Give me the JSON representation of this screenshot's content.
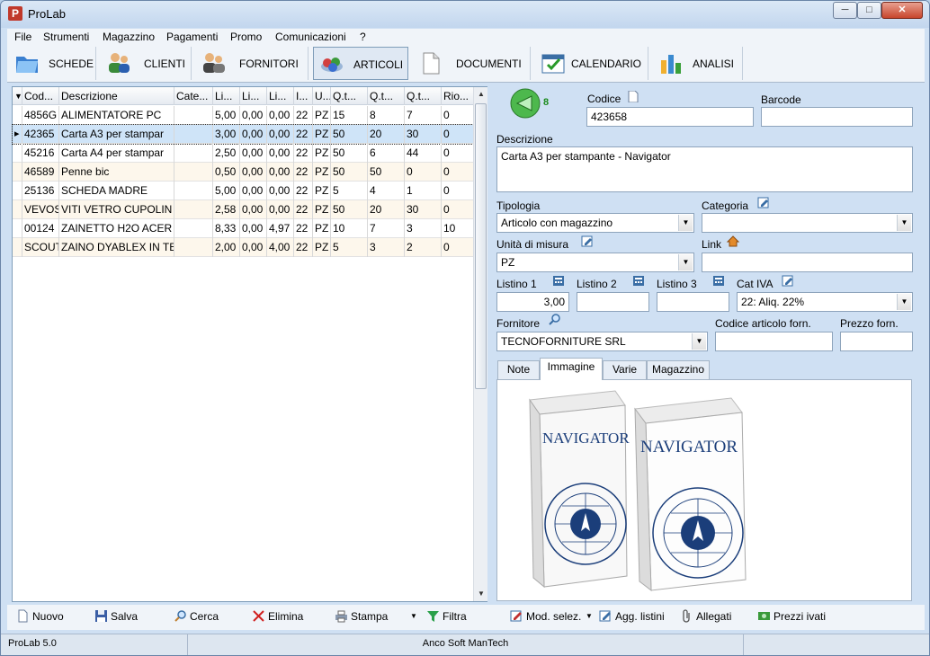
{
  "window": {
    "title": "ProLab"
  },
  "menu": [
    "File",
    "Strumenti",
    "Magazzino",
    "Pagamenti",
    "Promo",
    "Comunicazioni",
    "?"
  ],
  "toolbar": [
    "SCHEDE",
    "CLIENTI",
    "FORNITORI",
    "ARTICOLI",
    "DOCUMENTI",
    "CALENDARIO",
    "ANALISI"
  ],
  "grid": {
    "headers": [
      "Cod...",
      "Descrizione",
      "Cate...",
      "Li...",
      "Li...",
      "Li...",
      "I...",
      "U...",
      "Q.t...",
      "Q.t...",
      "Q.t...",
      "Rio..."
    ],
    "rows": [
      [
        "4856G",
        "ALIMENTATORE PC",
        "",
        "5,00",
        "0,00",
        "0,00",
        "22",
        "PZ",
        "15",
        "8",
        "7",
        "0"
      ],
      [
        "42365",
        "Carta A3 per stampar",
        "",
        "3,00",
        "0,00",
        "0,00",
        "22",
        "PZ",
        "50",
        "20",
        "30",
        "0"
      ],
      [
        "45216",
        "Carta A4 per stampar",
        "",
        "2,50",
        "0,00",
        "0,00",
        "22",
        "PZ",
        "50",
        "6",
        "44",
        "0"
      ],
      [
        "46589",
        "Penne bic",
        "",
        "0,50",
        "0,00",
        "0,00",
        "22",
        "PZ",
        "50",
        "50",
        "0",
        "0"
      ],
      [
        "25136",
        "SCHEDA MADRE",
        "",
        "5,00",
        "0,00",
        "0,00",
        "22",
        "PZ",
        "5",
        "4",
        "1",
        "0"
      ],
      [
        "VEVOS",
        "VITI VETRO CUPOLIN",
        "",
        "2,58",
        "0,00",
        "0,00",
        "22",
        "PZ",
        "50",
        "20",
        "30",
        "0"
      ],
      [
        "00124",
        "ZAINETTO H2O ACER",
        "",
        "8,33",
        "0,00",
        "4,97",
        "22",
        "PZ",
        "10",
        "7",
        "3",
        "10"
      ],
      [
        "SCOUT",
        "ZAINO DYABLEX IN TE",
        "",
        "2,00",
        "0,00",
        "4,00",
        "22",
        "PZ",
        "5",
        "3",
        "2",
        "0"
      ]
    ]
  },
  "form": {
    "nav_count": "8",
    "codice_label": "Codice",
    "codice_value": "423658",
    "barcode_label": "Barcode",
    "barcode_value": "",
    "descrizione_label": "Descrizione",
    "descrizione_value": "Carta A3 per stampante - Navigator",
    "tipologia_label": "Tipologia",
    "tipologia_value": "Articolo con magazzino",
    "categoria_label": "Categoria",
    "categoria_value": "",
    "unita_label": "Unità di misura",
    "unita_value": "PZ",
    "link_label": "Link",
    "link_value": "",
    "listino1_label": "Listino 1",
    "listino1_value": "3,00",
    "listino2_label": "Listino 2",
    "listino2_value": "",
    "listino3_label": "Listino 3",
    "listino3_value": "",
    "cativa_label": "Cat IVA",
    "cativa_value": "22: Aliq. 22%",
    "fornitore_label": "Fornitore",
    "fornitore_value": "TECNOFORNITURE SRL",
    "codforn_label": "Codice articolo forn.",
    "codforn_value": "",
    "prezzoforn_label": "Prezzo forn.",
    "prezzoforn_value": "",
    "tabs": [
      "Note",
      "Immagine",
      "Varie",
      "Magazzino"
    ],
    "product_brand": "NAVIGATOR"
  },
  "bottom": [
    "Nuovo",
    "Salva",
    "Cerca",
    "Elimina",
    "Stampa",
    "Filtra",
    "Mod. selez.",
    "Agg. listini",
    "Allegati",
    "Prezzi ivati"
  ],
  "status": [
    "ProLab 5.0",
    "Anco Soft ManTech",
    ""
  ]
}
